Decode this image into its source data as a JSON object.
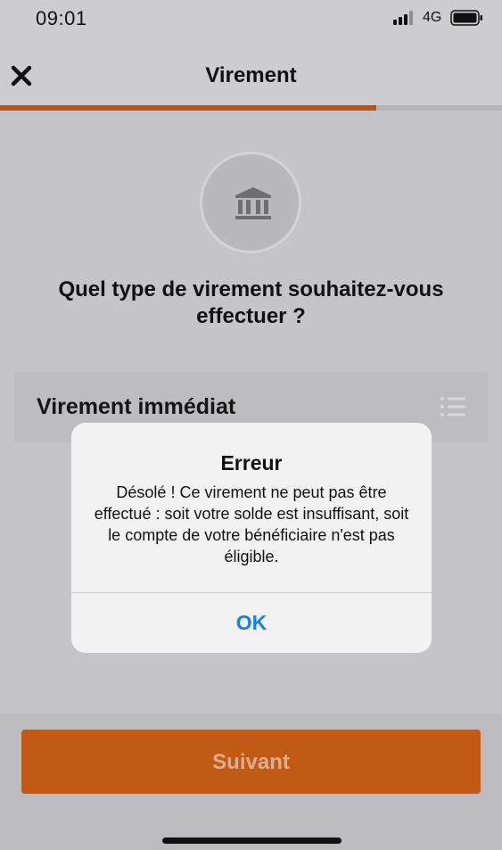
{
  "status_bar": {
    "time": "09:01",
    "network": "4G",
    "signal_icon": "signal-bars-icon",
    "battery_icon": "battery-icon"
  },
  "header": {
    "close_icon": "close-icon",
    "title": "Virement",
    "progress": 0.75,
    "progress_color": "#b3561b"
  },
  "main": {
    "bank_icon": "bank-icon",
    "question": "Quel type de virement souhaitez-vous effectuer ?",
    "select": {
      "value": "Virement immédiat",
      "icon": "list-icon"
    }
  },
  "footer": {
    "next_label": "Suivant",
    "next_color": "#c05a14"
  },
  "alert": {
    "title": "Erreur",
    "message": "Désolé ! Ce virement ne peut pas être effectué : soit votre solde est insuffisant, soit le compte de votre bénéficiaire n'est pas éligible.",
    "ok_label": "OK",
    "ok_color": "#1a7fe0"
  }
}
